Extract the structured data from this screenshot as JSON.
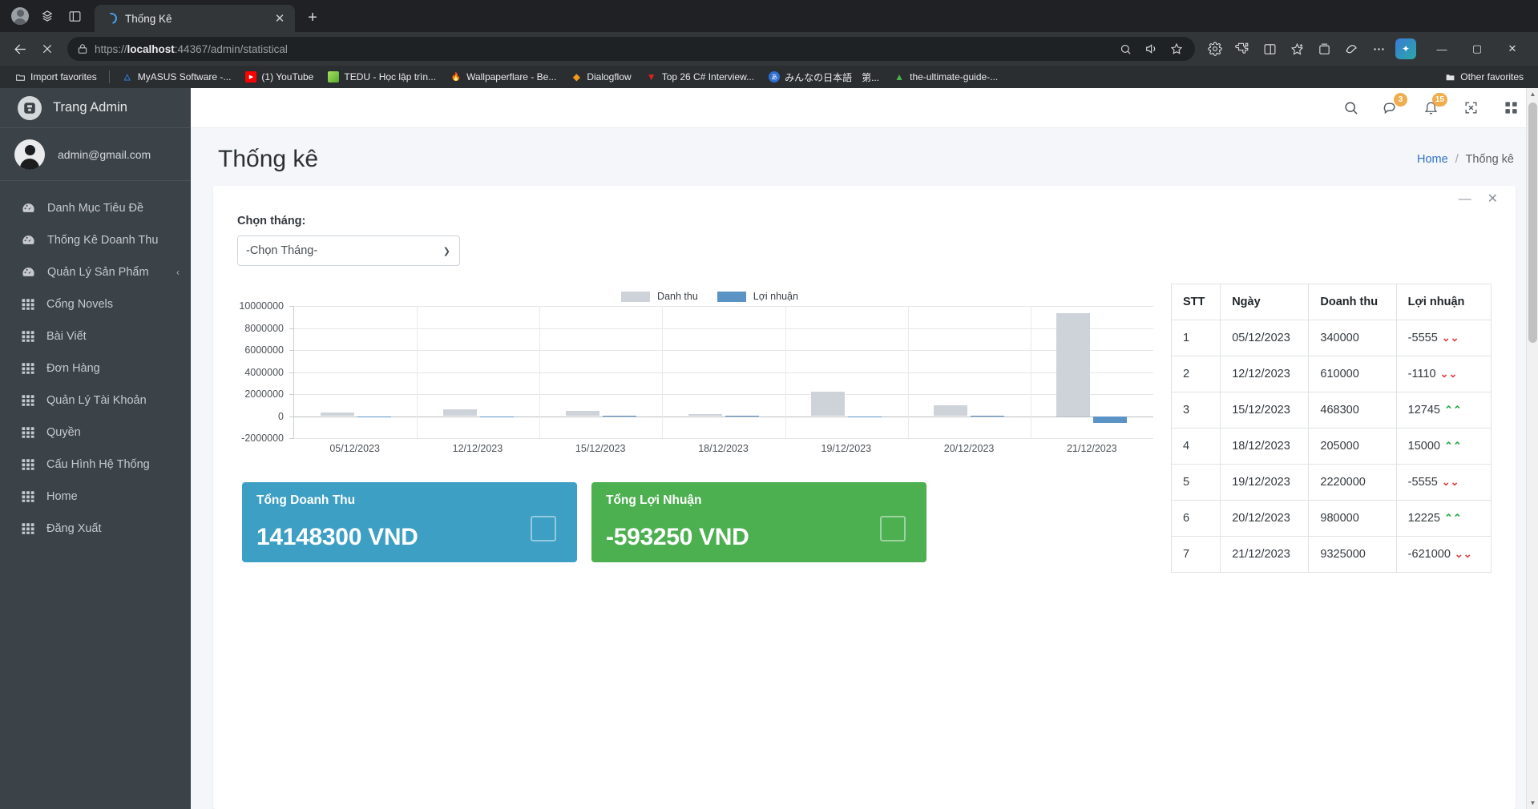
{
  "browser": {
    "tab": {
      "title": "Thống Kê",
      "close_label": "✕",
      "loading": true
    },
    "newtab_label": "+",
    "url": {
      "scheme": "https://",
      "host": "localhost",
      "rest": ":44367/admin/statistical"
    },
    "window_controls": {
      "minimize": "—",
      "maximize": "▢",
      "close": "✕"
    },
    "bookmarks": [
      {
        "label": "Import favorites",
        "icon": "folder-import-icon",
        "color": "#cfd2d4",
        "glyph": ""
      },
      {
        "label": "MyASUS Software -...",
        "icon": "myasus-icon",
        "color": "#2f6fd0",
        "glyph": "A"
      },
      {
        "label": "(1) YouTube",
        "icon": "youtube-icon",
        "color": "#ff0000",
        "glyph": "▶"
      },
      {
        "label": "TEDU - Học lập trìn...",
        "icon": "tedu-icon",
        "color": "#8bc34a",
        "glyph": ""
      },
      {
        "label": "Wallpaperflare - Be...",
        "icon": "wallpaperflare-icon",
        "color": "#ff7043",
        "glyph": "🔥"
      },
      {
        "label": "Dialogflow",
        "icon": "dialogflow-icon",
        "color": "#ef9a1e",
        "glyph": "◆"
      },
      {
        "label": "Top 26 C# Interview...",
        "icon": "toptal-icon",
        "color": "#e02020",
        "glyph": "▼"
      },
      {
        "label": "みんなの日本語　第...",
        "icon": "nihongo-icon",
        "color": "#3a7bd5",
        "glyph": "あ"
      },
      {
        "label": "the-ultimate-guide-...",
        "icon": "guide-icon",
        "color": "#4caf50",
        "glyph": "▲"
      }
    ],
    "other_favorites": {
      "label": "Other favorites",
      "icon": "folder-icon"
    }
  },
  "sidebar": {
    "brand": "Trang Admin",
    "user_email": "admin@gmail.com",
    "items": [
      {
        "label": "Danh Mục Tiêu Đề",
        "icon": "gauge-icon",
        "chevron": ""
      },
      {
        "label": "Thống Kê Doanh Thu",
        "icon": "gauge-icon",
        "chevron": ""
      },
      {
        "label": "Quản Lý Sản Phẩm",
        "icon": "gauge-icon",
        "chevron": "‹"
      },
      {
        "label": "Cổng Novels",
        "icon": "grid-icon",
        "chevron": ""
      },
      {
        "label": "Bài Viết",
        "icon": "grid-icon",
        "chevron": ""
      },
      {
        "label": "Đơn Hàng",
        "icon": "grid-icon",
        "chevron": ""
      },
      {
        "label": "Quản Lý Tài Khoản",
        "icon": "grid-icon",
        "chevron": ""
      },
      {
        "label": "Quyền",
        "icon": "grid-icon",
        "chevron": ""
      },
      {
        "label": "Cấu Hình Hệ Thống",
        "icon": "grid-icon",
        "chevron": ""
      },
      {
        "label": "Home",
        "icon": "grid-icon",
        "chevron": ""
      },
      {
        "label": "Đăng Xuất",
        "icon": "grid-icon",
        "chevron": ""
      }
    ]
  },
  "topbar": {
    "search_icon": "search-icon",
    "messages": {
      "icon": "messages-icon",
      "count": "3",
      "color": "#f0ad4e"
    },
    "notifications": {
      "icon": "bell-icon",
      "count": "15",
      "color": "#f0ad4e"
    },
    "fullscreen_icon": "fullscreen-icon",
    "apps_icon": "apps-grid-icon"
  },
  "header": {
    "title": "Thống kê",
    "breadcrumb_home": "Home",
    "breadcrumb_sep": "/",
    "breadcrumb_current": "Thống kê"
  },
  "card": {
    "minimize_label": "—",
    "close_label": "✕",
    "filter_label": "Chọn tháng:",
    "select_value": "-Chọn Tháng-",
    "select_options": [
      "-Chọn Tháng-"
    ]
  },
  "chart_data": {
    "type": "bar",
    "title": "",
    "xlabel": "",
    "ylabel": "",
    "grid": true,
    "legend_position": "top-center",
    "categories": [
      "05/12/2023",
      "12/12/2023",
      "15/12/2023",
      "18/12/2023",
      "19/12/2023",
      "20/12/2023",
      "21/12/2023"
    ],
    "ylim": [
      -2000000,
      10000000
    ],
    "yticks": [
      10000000,
      8000000,
      6000000,
      4000000,
      2000000,
      0,
      -2000000
    ],
    "ytick_labels": [
      "10000000",
      "8000000",
      "6000000",
      "4000000",
      "2000000",
      "0",
      "-2000000"
    ],
    "series": [
      {
        "name": "Danh thu",
        "color": "#ced3da",
        "values": [
          340000,
          610000,
          468300,
          205000,
          2220000,
          980000,
          9325000
        ]
      },
      {
        "name": "Lợi nhuận",
        "color": "#5b93c4",
        "values": [
          -5555,
          -1110,
          12745,
          15000,
          -5555,
          12225,
          -621000
        ]
      }
    ]
  },
  "table": {
    "columns": [
      "STT",
      "Ngày",
      "Doanh thu",
      "Lợi nhuận"
    ],
    "rows": [
      {
        "stt": "1",
        "ngay": "05/12/2023",
        "doanhthu": "340000",
        "loinhuan": "-5555",
        "trend": "down"
      },
      {
        "stt": "2",
        "ngay": "12/12/2023",
        "doanhthu": "610000",
        "loinhuan": "-1110",
        "trend": "down"
      },
      {
        "stt": "3",
        "ngay": "15/12/2023",
        "doanhthu": "468300",
        "loinhuan": "12745",
        "trend": "up"
      },
      {
        "stt": "4",
        "ngay": "18/12/2023",
        "doanhthu": "205000",
        "loinhuan": "15000",
        "trend": "up"
      },
      {
        "stt": "5",
        "ngay": "19/12/2023",
        "doanhthu": "2220000",
        "loinhuan": "-5555",
        "trend": "down"
      },
      {
        "stt": "6",
        "ngay": "20/12/2023",
        "doanhthu": "980000",
        "loinhuan": "12225",
        "trend": "up"
      },
      {
        "stt": "7",
        "ngay": "21/12/2023",
        "doanhthu": "9325000",
        "loinhuan": "-621000",
        "trend": "down"
      }
    ],
    "trend_up_glyph": "⌃⌃",
    "trend_down_glyph": "⌄⌄"
  },
  "summary": [
    {
      "title": "Tổng Doanh Thu",
      "value": "14148300 VND",
      "color": "#3d9fc4",
      "icon": "square-icon"
    },
    {
      "title": "Tổng Lợi Nhuận",
      "value": "-593250 VND",
      "color": "#4caf50",
      "icon": "square-icon"
    }
  ]
}
